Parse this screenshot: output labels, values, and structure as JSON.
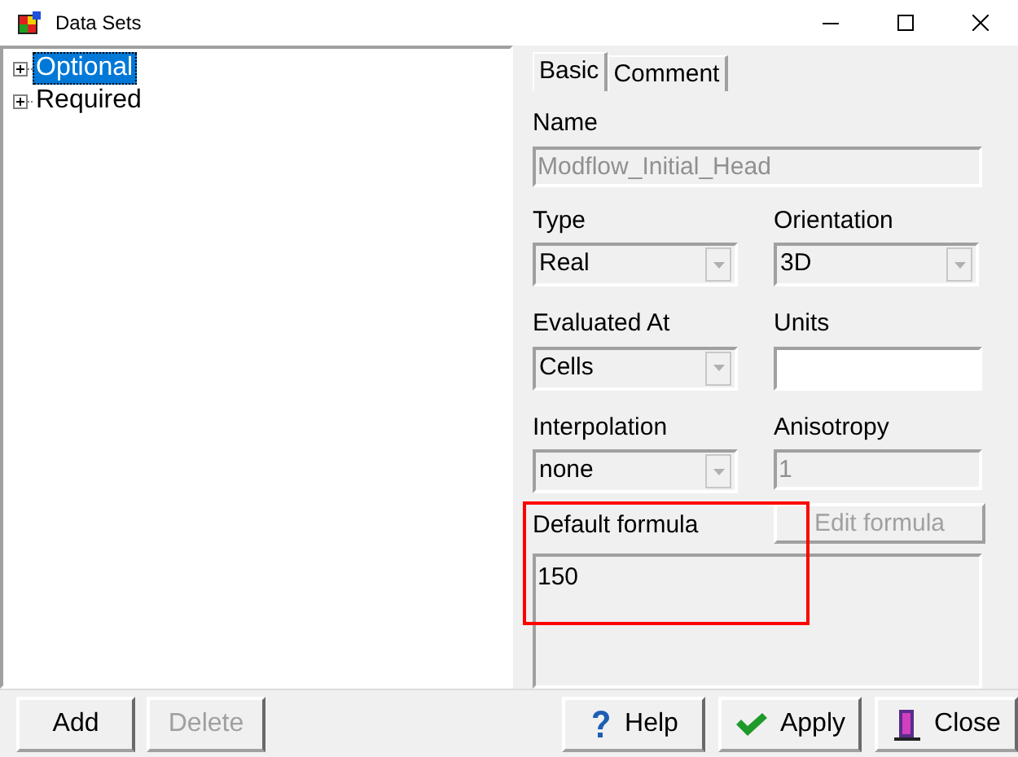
{
  "window": {
    "title": "Data Sets"
  },
  "tree": [
    {
      "label": "Optional",
      "expanded": false,
      "selected": true
    },
    {
      "label": "Required",
      "expanded": false,
      "selected": false
    }
  ],
  "tabs": [
    {
      "label": "Basic",
      "selected": true
    },
    {
      "label": "Comment",
      "selected": false
    }
  ],
  "name": {
    "label": "Name",
    "value": "Modflow_Initial_Head",
    "disabled": true
  },
  "type": {
    "label": "Type",
    "value": "Real",
    "disabled": true
  },
  "orientation": {
    "label": "Orientation",
    "value": "3D",
    "disabled": true
  },
  "evaluated_at": {
    "label": "Evaluated At",
    "value": "Cells",
    "disabled": true
  },
  "units": {
    "label": "Units",
    "disabled": false
  },
  "interpolation": {
    "label": "Interpolation",
    "value": "none",
    "disabled": true
  },
  "anisotropy": {
    "label": "Anisotropy",
    "value": "1",
    "disabled": true
  },
  "edit_formula": {
    "label": "Edit formula",
    "disabled": true
  },
  "default_formula": {
    "label": "Default formula",
    "value": "150",
    "highlighted": true
  },
  "left_buttons": [
    {
      "label": "Add",
      "disabled": false
    },
    {
      "label": "Delete",
      "disabled": true
    }
  ],
  "right_buttons": [
    {
      "label": "Help",
      "kind": "help"
    },
    {
      "label": "Apply",
      "kind": "apply"
    },
    {
      "label": "Close",
      "kind": "close"
    }
  ]
}
